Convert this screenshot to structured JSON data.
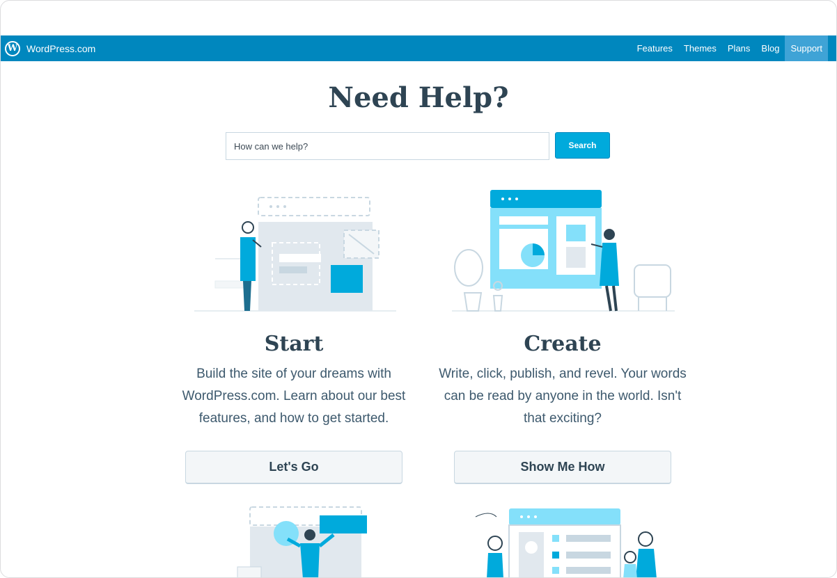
{
  "masterbar": {
    "brand": "WordPress.com",
    "logo_icon": "wordpress-logo-icon",
    "nav": [
      {
        "label": "Features"
      },
      {
        "label": "Themes"
      },
      {
        "label": "Plans"
      },
      {
        "label": "Blog"
      },
      {
        "label": "Support",
        "active": true
      }
    ]
  },
  "hero": {
    "title": "Need Help?",
    "search_placeholder": "How can we help?",
    "search_value": "",
    "search_button": "Search"
  },
  "cards": [
    {
      "title": "Start",
      "description": "Build the site of your dreams with WordPress.com. Learn about our best features, and how to get started.",
      "button": "Let's Go",
      "illustration": "start-illustration"
    },
    {
      "title": "Create",
      "description": "Write, click, publish, and revel. Your words can be read by anyone in the world. Isn't that exciting?",
      "button": "Show Me How",
      "illustration": "create-illustration"
    }
  ],
  "colors": {
    "brand_blue": "#0087be",
    "active_nav": "#3fa3d6",
    "search_button": "#00aadc",
    "heading": "#2e4453",
    "illustration_blue": "#00aadc",
    "illustration_light_blue": "#84e0fa"
  }
}
